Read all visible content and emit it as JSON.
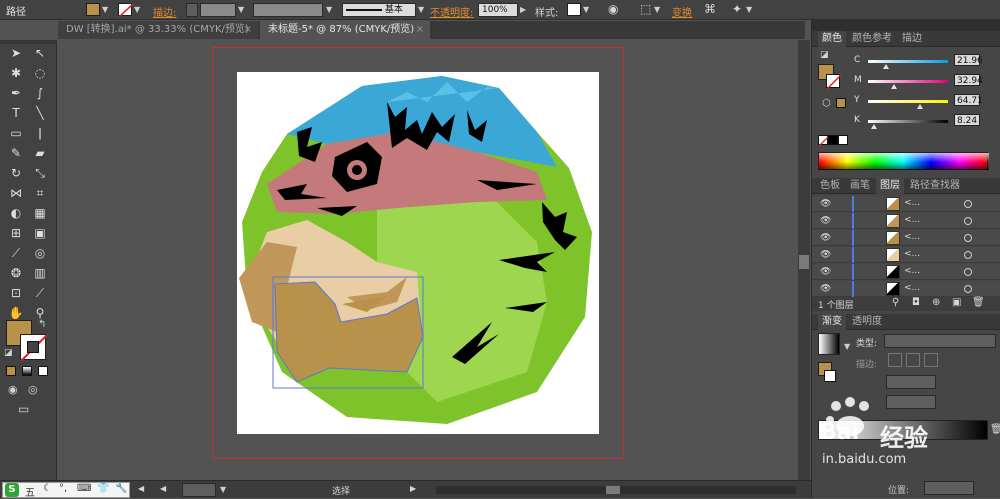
{
  "control_bar": {
    "object_type": "路径",
    "stroke_label": "描边:",
    "stroke_profile": "基本",
    "opacity_label": "不透明度:",
    "opacity_value": "100%",
    "style_label": "样式:",
    "transform_label": "变换",
    "fill_color": "#b8914a"
  },
  "tabs": [
    {
      "label": "DW [转换].ai* @ 33.33% (CMYK/预览)"
    },
    {
      "label": "未标题-5* @ 87% (CMYK/预览)"
    }
  ],
  "color_panel": {
    "tabs": [
      "颜色",
      "颜色参考",
      "描边"
    ],
    "channels": [
      {
        "name": "C",
        "value": "21.96",
        "fraction": 0.22,
        "gradient": "linear-gradient(to right,#fff,#00a0e0)"
      },
      {
        "name": "M",
        "value": "32.94",
        "fraction": 0.33,
        "gradient": "linear-gradient(to right,#fff,#e0007a)"
      },
      {
        "name": "Y",
        "value": "64.71",
        "fraction": 0.65,
        "gradient": "linear-gradient(to right,#fff,#fff000)"
      },
      {
        "name": "K",
        "value": "8.24",
        "fraction": 0.08,
        "gradient": "linear-gradient(to right,#fff,#000)"
      }
    ],
    "fill_color": "#b8914a"
  },
  "layers_panel": {
    "tabs": [
      "色板",
      "画笔",
      "图层",
      "路径查找器"
    ],
    "rows": [
      {
        "name": "<..."
      },
      {
        "name": "<..."
      },
      {
        "name": "<..."
      },
      {
        "name": "<..."
      },
      {
        "name": "<..."
      },
      {
        "name": "<..."
      }
    ],
    "footer": "1 个图层"
  },
  "gradient_panel": {
    "tabs": [
      "渐变",
      "透明度"
    ],
    "type_label": "类型:",
    "stroke_label": "描边:",
    "position_label": "位置:"
  },
  "watermark": {
    "brand": "Bai",
    "text": "经验",
    "url": "in.baidu.com"
  },
  "taskbar": {
    "ime_text": "五",
    "status_text": "选择"
  }
}
